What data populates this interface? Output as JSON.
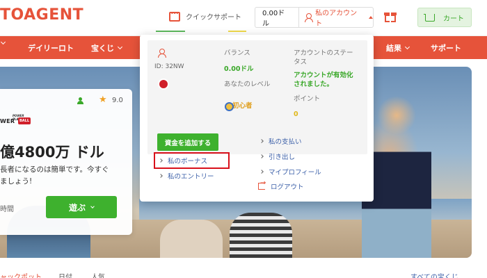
{
  "header": {
    "logo_text": "TOAGENT",
    "support_label": "クイックサポート",
    "balance": "0.00ドル",
    "my_account_label": "私のアカウント",
    "cart_label": "カート"
  },
  "nav": {
    "items": [
      {
        "label": "デイリーロト"
      },
      {
        "label": "宝くじ"
      },
      {
        "label": "結果"
      },
      {
        "label": "サポート"
      }
    ]
  },
  "lottery_card": {
    "rating": "9.0",
    "logo_top": "POWER PLAY",
    "logo_left": "WER",
    "logo_right": "BALL",
    "jackpot": "億4800万 ドル",
    "desc_line1": "長者になるのは簡単です。今すぐ",
    "desc_line2": "ましょう!",
    "time_label": "時間",
    "play_label": "遊ぶ"
  },
  "bottom_tabs": {
    "items": [
      {
        "label": "ャックポット"
      },
      {
        "label": "日付"
      },
      {
        "label": "人気"
      },
      {
        "label": "すべての宝くじ"
      }
    ]
  },
  "account_dropdown": {
    "user_id": "ID: 32NW",
    "balance_label": "バランス",
    "balance_value": "0.00ドル",
    "status_label_line1": "アカウントのステー",
    "status_label_line2": "タス",
    "status_value_line1": "アカウントが有効化",
    "status_value_line2": "されました。",
    "level_label": "あなたのレベル",
    "level_value": "初心者",
    "points_label": "ポイント",
    "points_value": "0",
    "add_funds_label": "資金を追加する",
    "links": {
      "my_bonus": "私のボーナス",
      "my_entries": "私のエントリー",
      "my_payments": "私の支払い",
      "withdraw": "引き出し",
      "my_profile": "マイプロフィール",
      "logout": "ログアウト"
    }
  },
  "colors": {
    "brand_orange": "#e6533a",
    "accent_green": "#3eb12e",
    "link_blue": "#3b5fa8",
    "highlight_red": "#d8101a"
  }
}
